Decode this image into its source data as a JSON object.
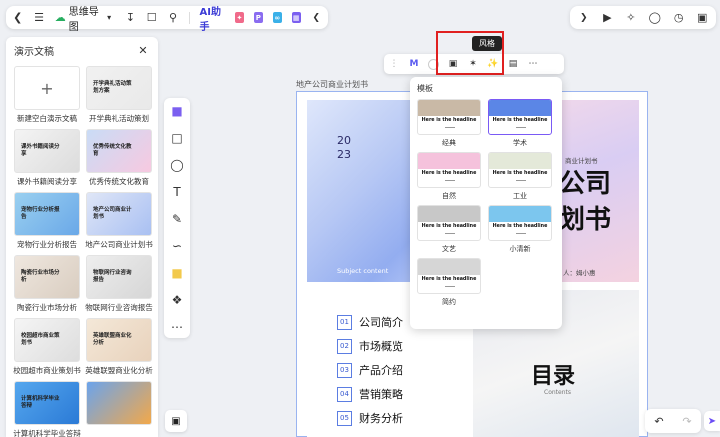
{
  "toolbar": {
    "back_icon": "chevron-left-icon",
    "menu_icon": "menu-icon",
    "doc_title": "思维导图",
    "ai_label": "AI助手",
    "accent": "#3b3bd6"
  },
  "panel": {
    "title": "演示文稿",
    "new_blank": "新建空白演示文稿",
    "templates": [
      {
        "caption": "开学典礼活动策划",
        "thumb_title": "开学典礼活动策划方案",
        "colors": [
          "#f1f1f1",
          "#e9e9e9"
        ]
      },
      {
        "caption": "课外书籍阅读分享",
        "thumb_title": "课外书籍阅读分享",
        "colors": [
          "#f4f4f4",
          "#dcdcdc"
        ]
      },
      {
        "caption": "优秀传统文化教育",
        "thumb_title": "优秀传统文化教育",
        "colors": [
          "#c9dcf6",
          "#f7c9e0"
        ]
      },
      {
        "caption": "宠物行业分析报告",
        "thumb_title": "宠物行业分析报告",
        "colors": [
          "#9ad0f0",
          "#6aa8e8"
        ]
      },
      {
        "caption": "地产公司商业计划书",
        "thumb_title": "地产公司商业计划书",
        "colors": [
          "#dfe6f7",
          "#a9c0f2"
        ]
      },
      {
        "caption": "陶瓷行业市场分析",
        "thumb_title": "陶瓷行业市场分析",
        "colors": [
          "#efe7df",
          "#d9cdc0"
        ]
      },
      {
        "caption": "物联网行业咨询报告",
        "thumb_title": "物联网行业咨询报告",
        "colors": [
          "#eeeeee",
          "#d6d6d6"
        ]
      },
      {
        "caption": "校园超市商业策划书",
        "thumb_title": "校园超市商业策划书",
        "colors": [
          "#f5f5f5",
          "#dddddd"
        ]
      },
      {
        "caption": "英雄联盟商业化分析",
        "thumb_title": "英雄联盟商业化分析",
        "colors": [
          "#f4e8d8",
          "#e8d2bc"
        ]
      },
      {
        "caption": "计算机科学毕业答辩",
        "thumb_title": "计算机科学毕业答辩",
        "colors": [
          "#55a7ee",
          "#2b7ad6"
        ]
      },
      {
        "caption": "",
        "thumb_title": "",
        "colors": [
          "#6ba4ec",
          "#f2a84a"
        ]
      }
    ]
  },
  "float_toolbar": {
    "tooltip": "风格"
  },
  "canvas": {
    "label": "地产公司商业计划书",
    "slide1": {
      "num": "20",
      "num2": "23",
      "sub": "Subject content"
    },
    "slide2": {
      "small": "商业计划书",
      "line1": "公司",
      "line2": "划书",
      "person": "人：姆小惠"
    },
    "toc": [
      {
        "n": "01",
        "t": "公司简介"
      },
      {
        "n": "02",
        "t": "市场概览"
      },
      {
        "n": "03",
        "t": "产品介绍"
      },
      {
        "n": "04",
        "t": "营销策略"
      },
      {
        "n": "05",
        "t": "财务分析"
      }
    ],
    "slide4": {
      "title": "目录",
      "sub": "Contents"
    }
  },
  "style_popover": {
    "header": "模板",
    "headline": "Here is the headline",
    "selected_accent": "#7a5af5",
    "styles": [
      {
        "name": "经典",
        "band": "#c9b9a6",
        "selected": false
      },
      {
        "name": "学术",
        "band": "#5b86e6",
        "selected": true
      },
      {
        "name": "自然",
        "band": "#f5c2dc",
        "selected": false
      },
      {
        "name": "工业",
        "band": "#e4e9d9",
        "selected": false
      },
      {
        "name": "文艺",
        "band": "#c8c8c8",
        "selected": false
      },
      {
        "name": "小清新",
        "band": "#7cc6ee",
        "selected": false
      },
      {
        "name": "简约",
        "band": "#d6d6d6",
        "selected": false
      }
    ]
  }
}
